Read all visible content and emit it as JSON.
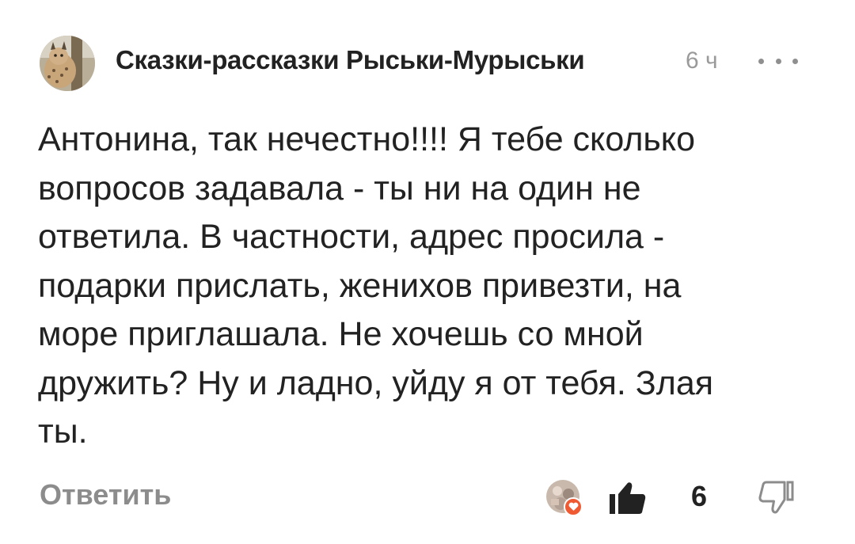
{
  "comment": {
    "author": "Сказки-рассказки Рыськи-Мурыськи",
    "time": "6 ч",
    "text": "Антонина, так нечестно!!!! Я тебе сколько\nвопросов задавала - ты ни на один не\nответила. В частности, адрес просила -\nподарки прислать, женихов привезти, на\nморе приглашала. Не хочешь со мной\nдружить? Ну и ладно, уйду я от тебя. Злая\nты."
  },
  "actions": {
    "reply_label": "Ответить",
    "like_count": "6"
  },
  "icons": {
    "more": "more-horizontal-icon",
    "reaction": "heart-icon",
    "like": "thumbs-up-icon",
    "dislike": "thumbs-down-icon"
  },
  "colors": {
    "text": "#222222",
    "muted": "#9a9a9a",
    "action": "#8c8c8c",
    "reaction_heart": "#f05a32"
  }
}
